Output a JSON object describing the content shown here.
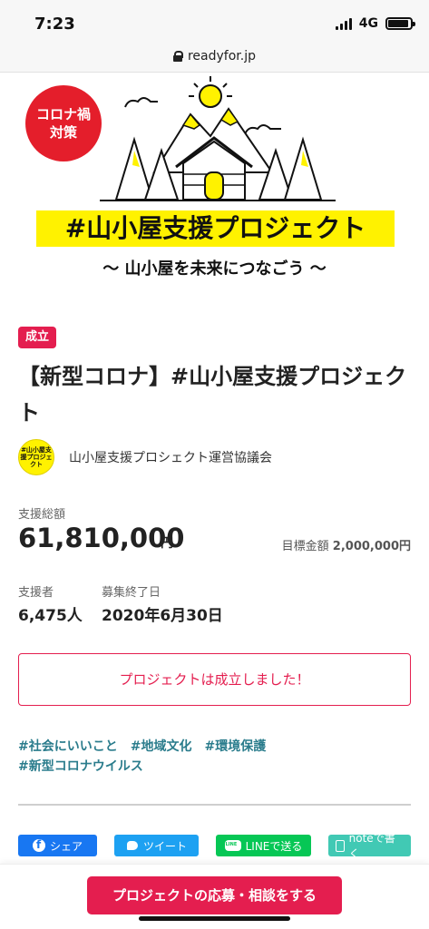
{
  "status_bar": {
    "time": "7:23",
    "network": "4G"
  },
  "browser": {
    "url": "readyfor.jp"
  },
  "hero": {
    "badge_line1": "コロナ禍",
    "badge_line2": "対策",
    "title": "#山小屋支援プロジェクト",
    "subtitle": "〜 山小屋を未来につなごう 〜",
    "accent_color": "#fff200"
  },
  "project": {
    "status_tag": "成立",
    "title": "【新型コロナ】#山小屋支援プロジェクト",
    "owner_avatar_text": "#山小屋支援プロジェクト",
    "owner_name": "山小屋支援プロシェクト運営協議会"
  },
  "stats": {
    "total_label": "支援総額",
    "total_amount": "61,810,000",
    "total_unit": "円",
    "goal_label": "目標金額",
    "goal_amount": "2,000,000円",
    "supporters_label": "支援者",
    "supporters_value": "6,475人",
    "end_label": "募集終了日",
    "end_value": "2020年6月30日"
  },
  "success_message": "プロジェクトは成立しました！",
  "tags": [
    "#社会にいいこと",
    "#地域文化",
    "#環境保護",
    "#新型コロナウイルス"
  ],
  "share": {
    "facebook": "シェア",
    "twitter": "ツイート",
    "line": "LINEで送る",
    "note": "noteで書く"
  },
  "cta_label": "プロジェクトの応募・相談をする",
  "colors": {
    "brand_red": "#e41e4f",
    "tag_teal": "#2a7c8c",
    "corona_red": "#e41e2b"
  }
}
